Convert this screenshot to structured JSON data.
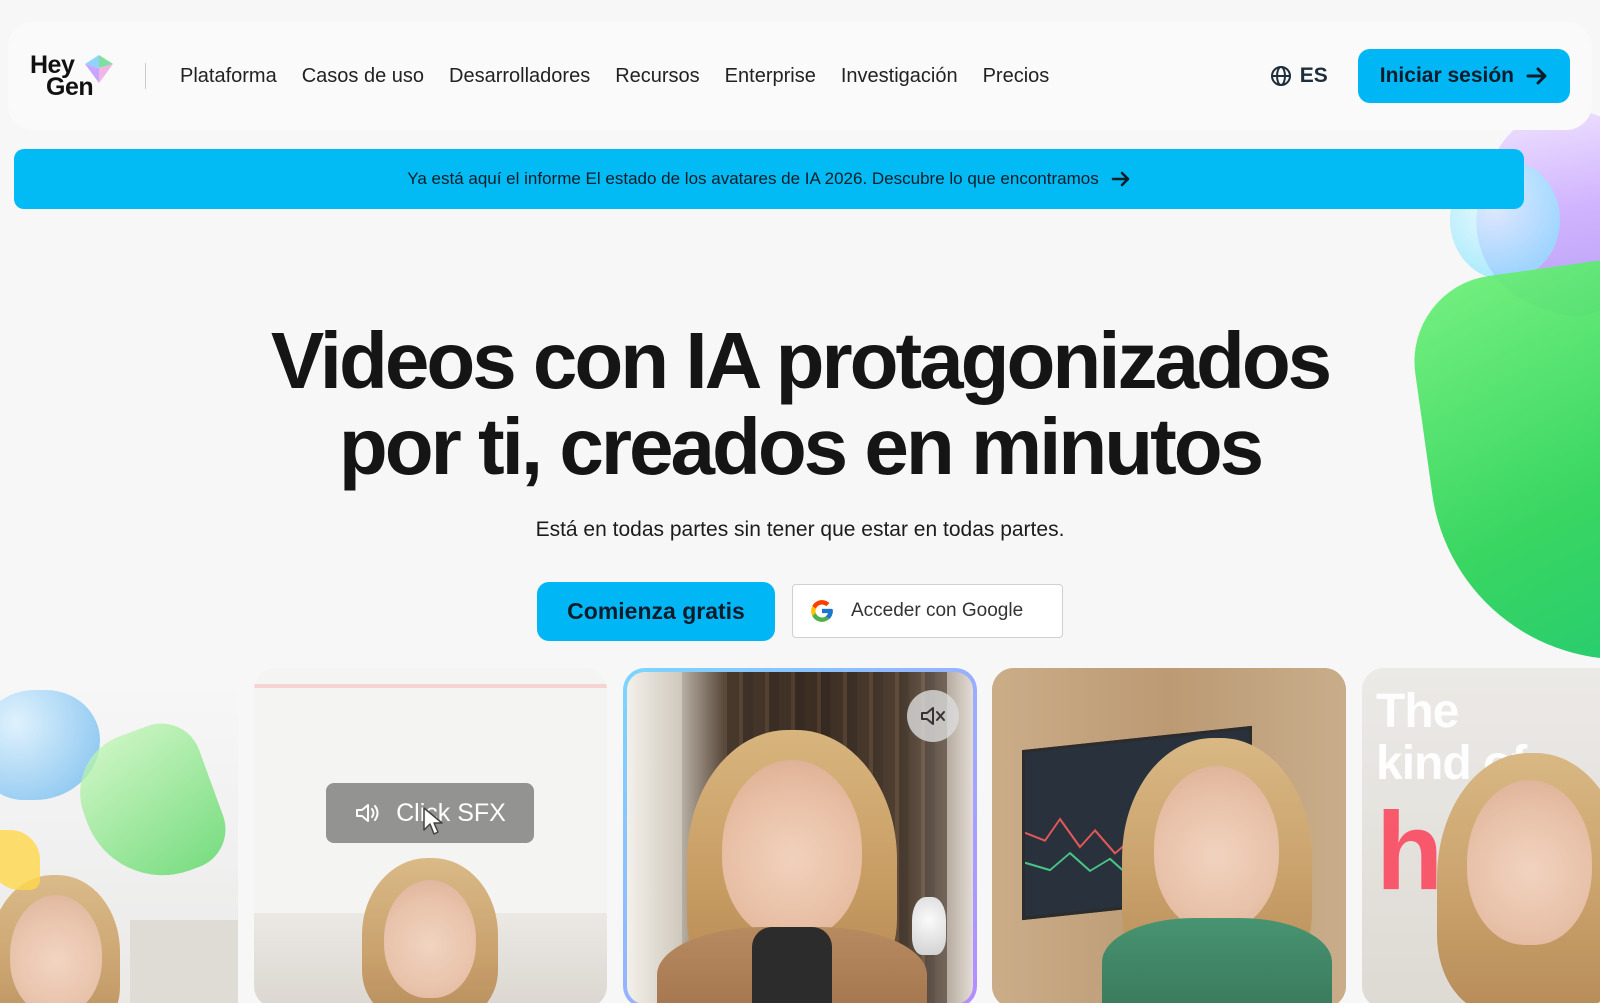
{
  "brand": {
    "logo_line1": "Hey",
    "logo_line2": "Gen",
    "accent": "#00b6f5"
  },
  "nav": {
    "links": [
      "Plataforma",
      "Casos de uso",
      "Desarrolladores",
      "Recursos",
      "Enterprise",
      "Investigación",
      "Precios"
    ],
    "language": "ES",
    "language_icon": "globe-icon",
    "login_label": "Iniciar sesión",
    "login_icon": "arrow-right-icon"
  },
  "banner": {
    "text": "Ya está aquí el informe El estado de los avatares de IA 2026. Descubre lo que encontramos",
    "icon": "arrow-right-icon"
  },
  "hero": {
    "title_line1": "Videos con IA protagonizados",
    "title_line2": "por ti, creados en minutos",
    "subtitle": "Está en todas partes sin tener que estar en todas partes.",
    "cta_primary": "Comienza gratis",
    "cta_google": "Acceder con Google",
    "google_icon": "google-icon"
  },
  "cards": {
    "sfx_label": "Click SFX",
    "sfx_icon": "speaker-icon",
    "mute_icon": "mute-icon",
    "card4_line1": "The",
    "card4_line2": "kind of",
    "card4_red": "h"
  }
}
